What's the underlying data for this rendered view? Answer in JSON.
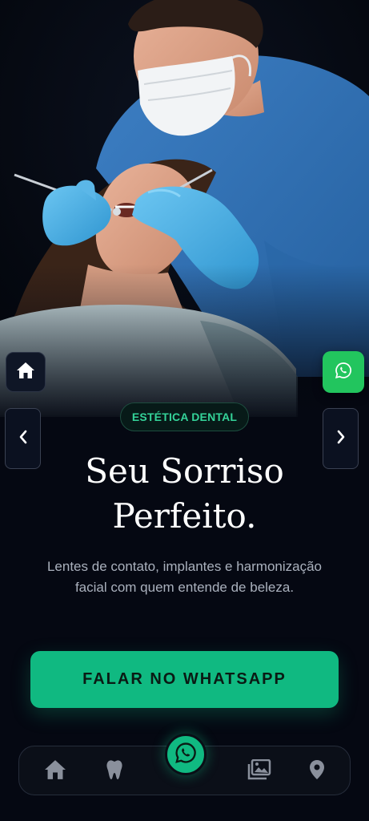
{
  "badge": "ESTÉTICA DENTAL",
  "headline": {
    "line1": "Seu Sorriso",
    "line2": "Perfeito."
  },
  "subtitle": "Lentes de contato, implantes e harmonização facial com quem entende de beleza.",
  "cta": "FALAR NO WHATSAPP",
  "colors": {
    "accent": "#10b981",
    "whatsapp": "#22c55e",
    "background": "#050812"
  },
  "icons": {
    "home_float": "home-icon",
    "whatsapp_float": "whatsapp-icon",
    "prev": "chevron-left-icon",
    "next": "chevron-right-icon",
    "nav_home": "home-icon",
    "nav_tooth": "tooth-icon",
    "nav_center": "whatsapp-icon",
    "nav_gallery": "gallery-icon",
    "nav_location": "map-pin-icon"
  }
}
